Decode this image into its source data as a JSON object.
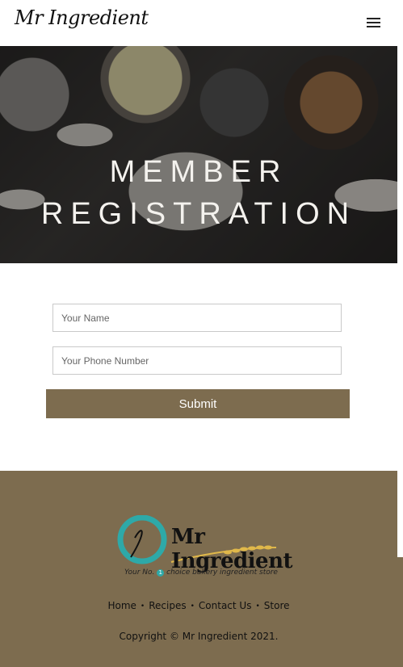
{
  "header": {
    "brand": "Mr Ingredient",
    "menu_icon": "hamburger-menu-icon"
  },
  "hero": {
    "title_line1": "MEMBER",
    "title_line2": "REGISTRATION"
  },
  "form": {
    "name_placeholder": "Your Name",
    "phone_placeholder": "Your Phone Number",
    "submit_label": "Submit"
  },
  "footer": {
    "logo_text": "Mr Ingredient",
    "logo_tagline_before": "Your No.",
    "logo_tagline_number": "1",
    "logo_tagline_after": "choice bakery ingredient store",
    "nav": [
      "Home",
      "Recipes",
      "Contact Us",
      "Store"
    ],
    "copyright": "Copyright © Mr Ingredient 2021."
  },
  "colors": {
    "accent": "#7d6c4f",
    "teal": "#2ea9a8",
    "gold": "#e0b84a"
  }
}
